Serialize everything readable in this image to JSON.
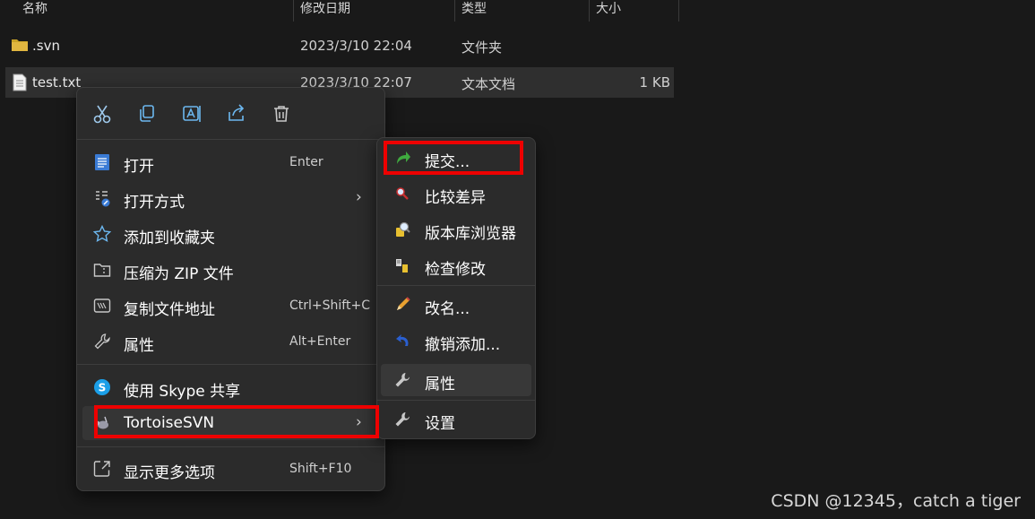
{
  "columns": [
    "名称",
    "修改日期",
    "类型",
    "大小"
  ],
  "files": [
    {
      "name": ".svn",
      "date": "2023/3/10 22:04",
      "type": "文件夹",
      "size": ""
    },
    {
      "name": "test.txt",
      "date": "2023/3/10 22:07",
      "type": "文本文档",
      "size": "1 KB"
    }
  ],
  "toolbar": {
    "cut": "cut-icon",
    "copy": "copy-icon",
    "rename": "rename-icon",
    "share": "share-icon",
    "delete": "trash-icon"
  },
  "menu": [
    {
      "label": "打开",
      "shortcut": "Enter"
    },
    {
      "label": "打开方式",
      "shortcut": ""
    },
    {
      "label": "添加到收藏夹",
      "shortcut": ""
    },
    {
      "label": "压缩为 ZIP 文件",
      "shortcut": ""
    },
    {
      "label": "复制文件地址",
      "shortcut": "Ctrl+Shift+C"
    },
    {
      "label": "属性",
      "shortcut": "Alt+Enter"
    },
    {
      "label": "使用 Skype 共享",
      "shortcut": ""
    },
    {
      "label": "TortoiseSVN",
      "shortcut": ""
    },
    {
      "label": "显示更多选项",
      "shortcut": "Shift+F10"
    }
  ],
  "arrow": "›",
  "submenu": [
    {
      "label": "提交..."
    },
    {
      "label": "比较差异"
    },
    {
      "label": "版本库浏览器"
    },
    {
      "label": "检查修改"
    },
    {
      "label": "改名..."
    },
    {
      "label": "撤销添加..."
    },
    {
      "label": "属性"
    },
    {
      "label": "设置"
    }
  ],
  "watermark": "CSDN @12345，catch a tiger",
  "colors": {
    "highlight": "#ee0000",
    "accent": "#4cc2ff",
    "background": "#191919",
    "menu_bg": "#2b2b2b"
  }
}
